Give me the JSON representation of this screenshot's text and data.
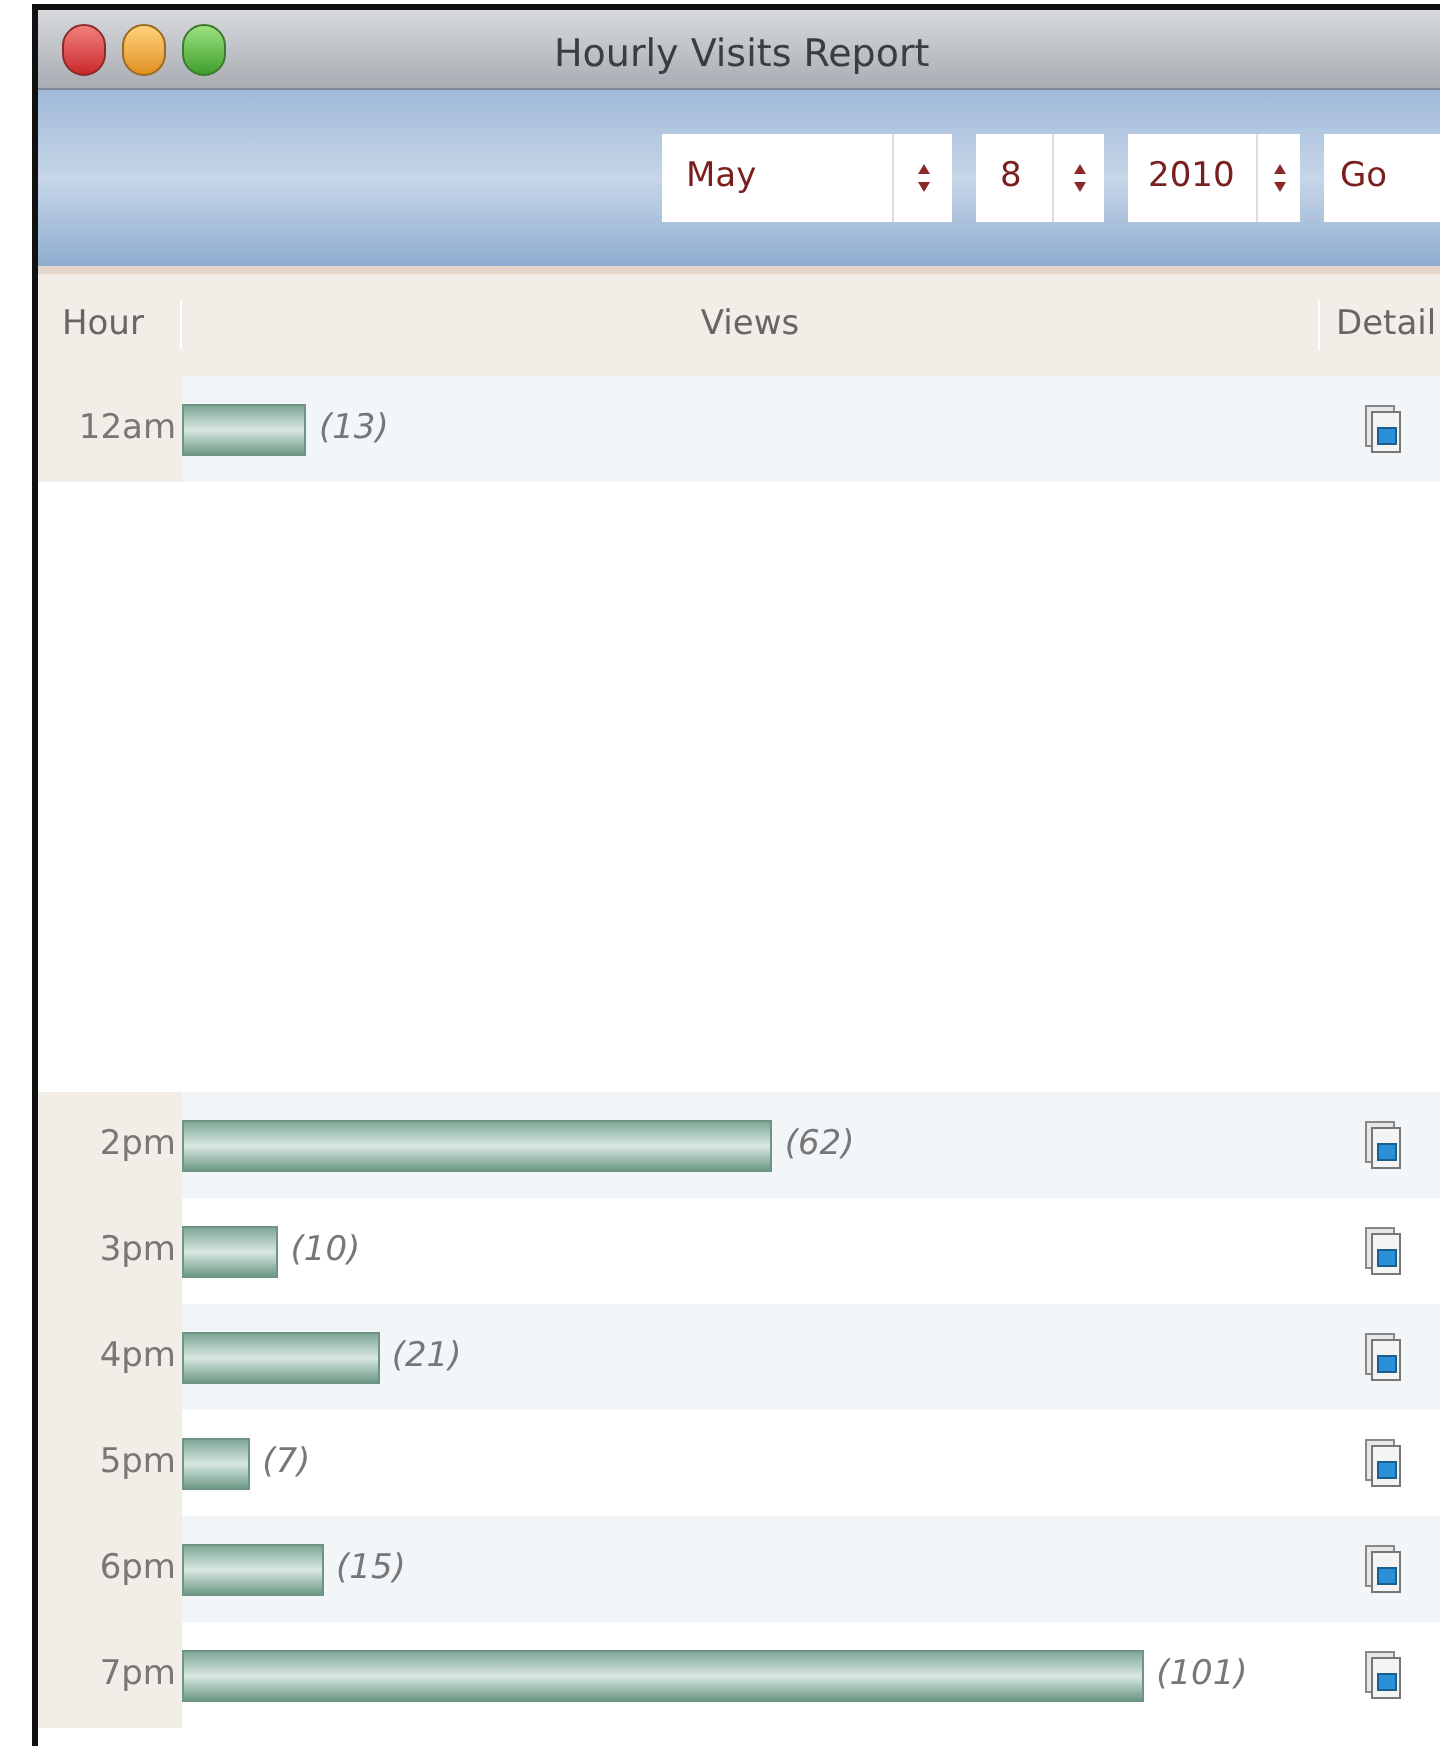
{
  "window": {
    "title": "Hourly Visits Report"
  },
  "toolbar": {
    "month": "May",
    "day": "8",
    "year": "2010",
    "go_button": "Go"
  },
  "table": {
    "columns": [
      "Hour",
      "Views",
      "Detail"
    ],
    "rows": [
      {
        "hour": "12am",
        "views": "(13)",
        "level": 0.11,
        "shaded": true
      },
      {
        "kind": "blank"
      },
      {
        "hour": "2pm",
        "views": "(62)",
        "level": 0.52,
        "shaded": true
      },
      {
        "hour": "3pm",
        "views": "(10)",
        "level": 0.085,
        "shaded": false
      },
      {
        "hour": "4pm",
        "views": "(21)",
        "level": 0.174,
        "shaded": true
      },
      {
        "hour": "5pm",
        "views": "(7)",
        "level": 0.06,
        "shaded": false
      },
      {
        "hour": "6pm",
        "views": "(15)",
        "level": 0.125,
        "shaded": true
      },
      {
        "hour": "7pm",
        "views": "(101)",
        "level": 0.847,
        "shaded": false
      }
    ]
  }
}
